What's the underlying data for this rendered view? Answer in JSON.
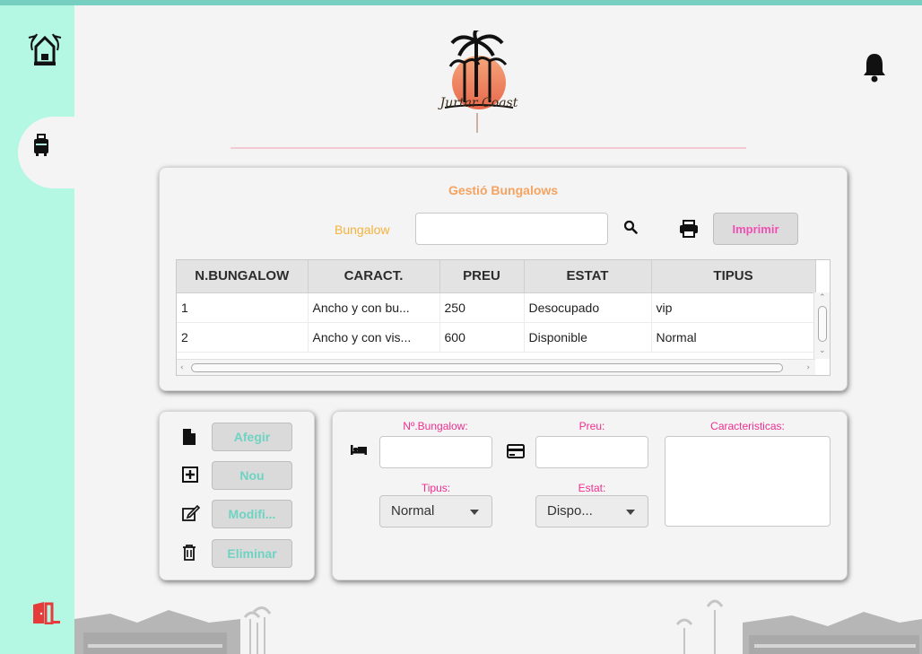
{
  "app": {
    "brand": "Jurtar Coast",
    "colors": {
      "sidebar": "#b4f8e4",
      "topbar": "#76cfc1",
      "title": "#f5a361",
      "search_label": "#f3b33e",
      "print_text": "#f34fb2",
      "action_text": "#6fd3c2",
      "field_label": "#ef2e8f",
      "logout": "#e53b3b"
    }
  },
  "sidebar": {
    "icons": [
      "home-palm-icon",
      "luggage-icon",
      "logout-door-icon"
    ]
  },
  "header": {
    "notification_icon": "bell-icon"
  },
  "main": {
    "title": "Gestió Bungalows",
    "search": {
      "label": "Bungalow",
      "value": "",
      "placeholder": ""
    },
    "print_label": "Imprimir",
    "table": {
      "columns": [
        "N.BUNGALOW",
        "CARACT.",
        "PREU",
        "ESTAT",
        "TIPUS"
      ],
      "rows": [
        [
          "1",
          "Ancho y con bu...",
          "250",
          "Desocupado",
          "vip"
        ],
        [
          "2",
          "Ancho y con vis...",
          "600",
          "Disponible",
          "Normal"
        ]
      ]
    }
  },
  "actions": {
    "add": "Afegir",
    "new": "Nou",
    "modify": "Modifi...",
    "delete": "Eliminar"
  },
  "form": {
    "num_label": "Nº.Bungalow:",
    "num_value": "",
    "price_label": "Preu:",
    "price_value": "",
    "features_label": "Caracteristicas:",
    "type_label": "Tipus:",
    "type_value": "Normal",
    "status_label": "Estat:",
    "status_value": "Dispo..."
  }
}
